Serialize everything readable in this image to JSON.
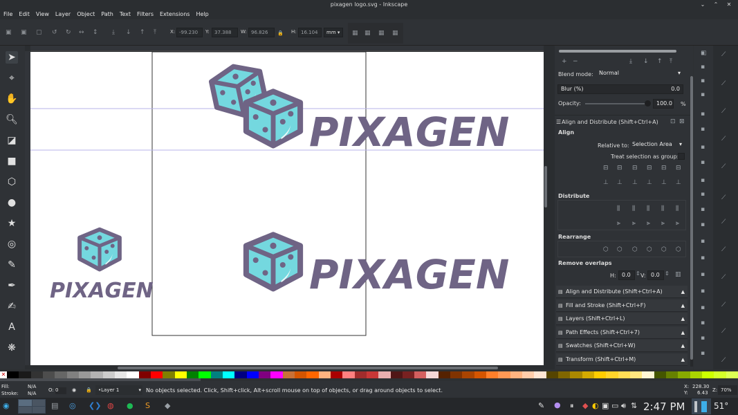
{
  "window": {
    "title": "pixagen logo.svg - Inkscape"
  },
  "menu": [
    "File",
    "Edit",
    "View",
    "Layer",
    "Object",
    "Path",
    "Text",
    "Filters",
    "Extensions",
    "Help"
  ],
  "toolbar": {
    "x_label": "X:",
    "x_value": "-99.230",
    "y_label": "Y:",
    "y_value": "37.388",
    "w_label": "W:",
    "w_value": "96.826",
    "h_label": "H:",
    "h_value": "16.104",
    "unit": "mm"
  },
  "logo": {
    "text": "PIXAGEN",
    "color": "#6f6485",
    "dice_color": "#74d8df"
  },
  "panel": {
    "blend_label": "Blend mode:",
    "blend_value": "Normal",
    "blur_label": "Blur (%)",
    "blur_value": "0.0",
    "opacity_label": "Opacity:",
    "opacity_value": "100.0",
    "opacity_unit": "%",
    "align_title": "Align and Distribute (Shift+Ctrl+A)",
    "align_label": "Align",
    "relative_label": "Relative to:",
    "relative_value": "Selection Area",
    "treat_label": "Treat selection as group:",
    "distribute_label": "Distribute",
    "rearrange_label": "Rearrange",
    "overlaps_label": "Remove overlaps",
    "h_label": "H:",
    "h_value": "0.0",
    "v_label": "V:",
    "v_value": "0.0"
  },
  "docks": [
    "Align and Distribute (Shift+Ctrl+A)",
    "Fill and Stroke (Shift+Ctrl+F)",
    "Layers (Shift+Ctrl+L)",
    "Path Effects  (Shift+Ctrl+7)",
    "Swatches (Shift+Ctrl+W)",
    "Transform (Shift+Ctrl+M)"
  ],
  "status": {
    "fill_label": "Fill:",
    "fill_value": "N/A",
    "stroke_label": "Stroke:",
    "stroke_value": "N/A",
    "opacity_label": "O:",
    "opacity_value": "0",
    "layer": "•Layer 1",
    "message": "No objects selected. Click, Shift+click, Alt+scroll mouse on top of objects, or drag around objects to select.",
    "x_label": "X:",
    "x_value": "228.30",
    "y_label": "Y:",
    "y_value": "6.43",
    "z_label": "Z:",
    "zoom": "70%"
  },
  "taskbar": {
    "time": "2:47 PM",
    "temp": "51°"
  },
  "palette": [
    "#000000",
    "#1a1a1a",
    "#333333",
    "#4d4d4d",
    "#666666",
    "#808080",
    "#999999",
    "#b3b3b3",
    "#cccccc",
    "#e6e6e6",
    "#ffffff",
    "#800000",
    "#ff0000",
    "#808000",
    "#ffff00",
    "#008000",
    "#00ff00",
    "#008080",
    "#00ffff",
    "#000080",
    "#0000ff",
    "#800080",
    "#ff00ff",
    "#c87137",
    "#d45500",
    "#ff6600",
    "#ffb380",
    "#aa0000",
    "#ff8080",
    "#a02c2c",
    "#c83737",
    "#e9afaf",
    "#501616",
    "#782121",
    "#d35f5f",
    "#f4d7d7",
    "#552200",
    "#803300",
    "#aa4400",
    "#d45500",
    "#ff7f2a",
    "#ff9955",
    "#ffb380",
    "#ffccaa",
    "#ffe6d5",
    "#554400",
    "#806600",
    "#aa8800",
    "#d4aa00",
    "#ffcc00",
    "#ffd42a",
    "#ffdd55",
    "#ffe680",
    "#fff6d5",
    "#445500",
    "#668000",
    "#88aa00",
    "#aad400",
    "#ccff00",
    "#d4ff2a",
    "#ddff55"
  ]
}
